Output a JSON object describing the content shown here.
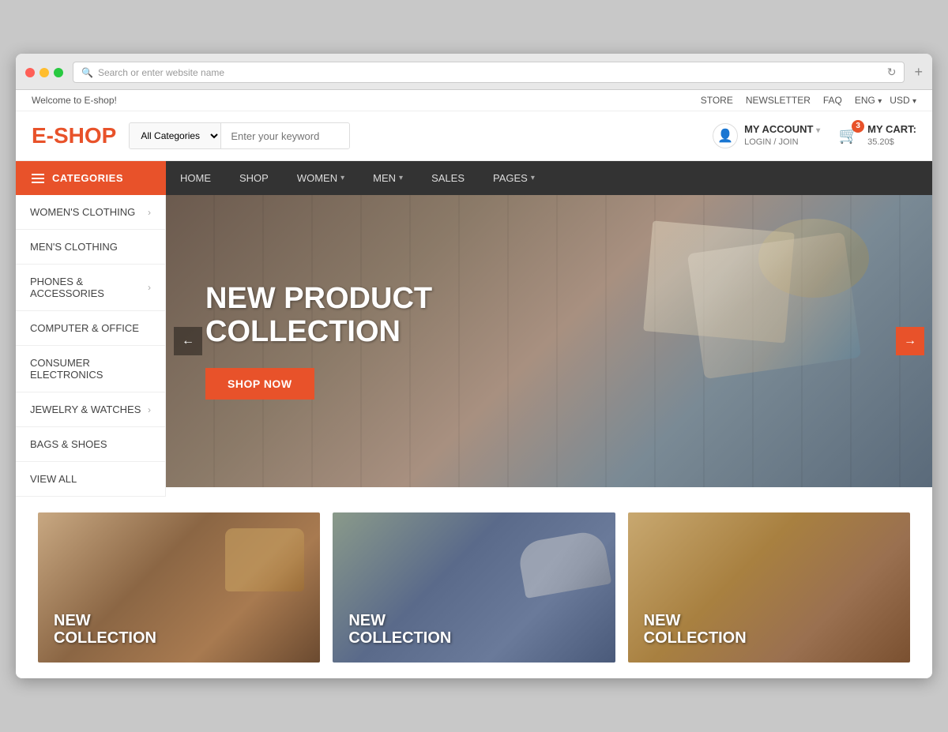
{
  "browser": {
    "address": "Search or enter website name"
  },
  "topbar": {
    "welcome": "Welcome to E-shop!",
    "store": "STORE",
    "newsletter": "NEWSLETTER",
    "faq": "FAQ",
    "lang": "ENG",
    "currency": "USD"
  },
  "header": {
    "logo_e": "E-",
    "logo_shop": "SHOP",
    "search_placeholder": "Enter your keyword",
    "search_category": "All Categories",
    "account_label": "MY ACCOUNT",
    "account_sub": "LOGIN / JOIN",
    "cart_label": "MY CART:",
    "cart_amount": "35.20$",
    "cart_count": "3"
  },
  "navbar": {
    "categories": "CATEGORIES",
    "links": [
      {
        "label": "HOME",
        "has_dropdown": false
      },
      {
        "label": "SHOP",
        "has_dropdown": false
      },
      {
        "label": "WOMEN",
        "has_dropdown": true
      },
      {
        "label": "MEN",
        "has_dropdown": true
      },
      {
        "label": "SALES",
        "has_dropdown": false
      },
      {
        "label": "PAGES",
        "has_dropdown": true
      }
    ]
  },
  "sidebar": {
    "items": [
      {
        "label": "WOMEN'S CLOTHING",
        "has_arrow": true
      },
      {
        "label": "MEN'S CLOTHING",
        "has_arrow": false
      },
      {
        "label": "PHONES & ACCESSORIES",
        "has_arrow": true
      },
      {
        "label": "COMPUTER & OFFICE",
        "has_arrow": false
      },
      {
        "label": "CONSUMER ELECTRONICS",
        "has_arrow": false
      },
      {
        "label": "JEWELRY & WATCHES",
        "has_arrow": true
      },
      {
        "label": "BAGS & SHOES",
        "has_arrow": false
      },
      {
        "label": "VIEW ALL",
        "has_arrow": false
      }
    ]
  },
  "hero": {
    "title_line1": "NEW PRODUCT",
    "title_line2": "COLLECTION",
    "shop_btn": "SHOP NOW",
    "prev_arrow": "←",
    "next_arrow": "→"
  },
  "product_cards": [
    {
      "label_line1": "NEW",
      "label_line2": "COLLECTION"
    },
    {
      "label_line1": "NEW",
      "label_line2": "COLLECTION"
    },
    {
      "label_line1": "NEW",
      "label_line2": "COLLECTION"
    }
  ]
}
